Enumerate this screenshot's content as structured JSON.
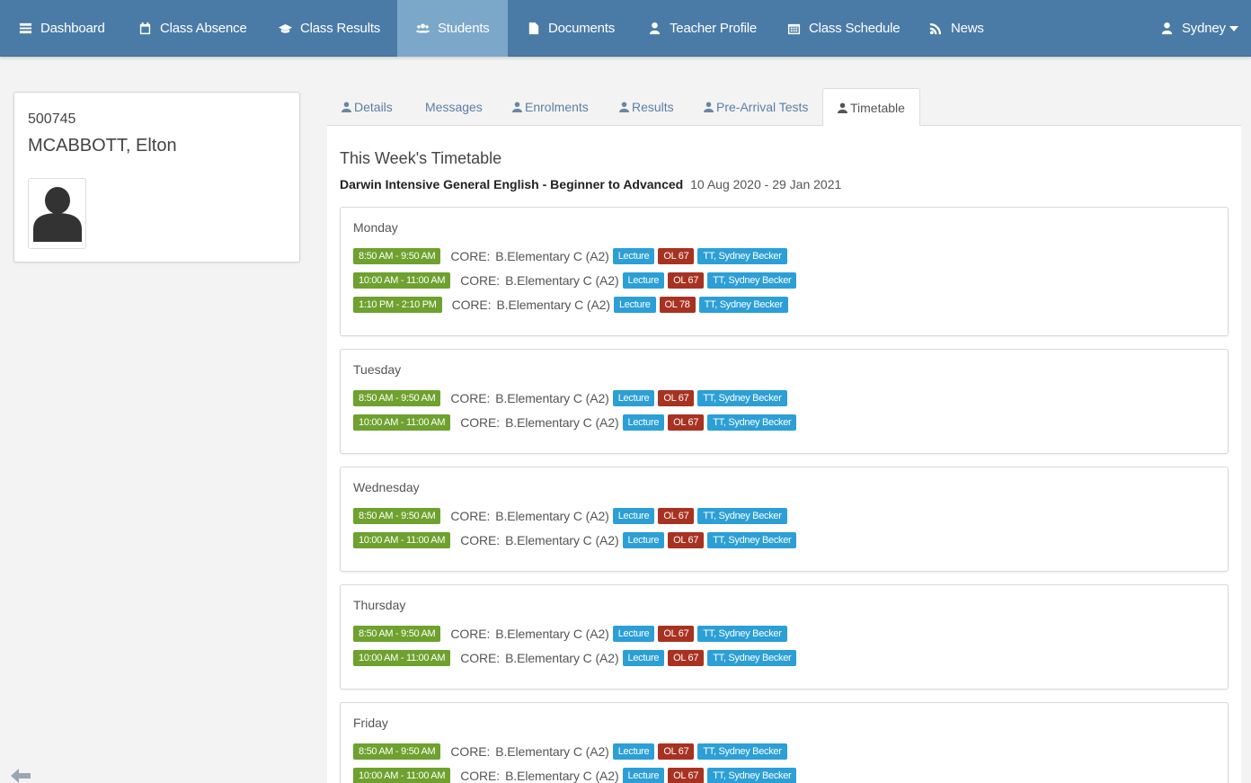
{
  "nav": {
    "dashboard": "Dashboard",
    "class_absence": "Class Absence",
    "class_results": "Class Results",
    "students": "Students",
    "documents": "Documents",
    "teacher_profile": "Teacher Profile",
    "class_schedule": "Class Schedule",
    "news": "News",
    "user": "Sydney"
  },
  "student": {
    "id": "500745",
    "name": "MCABBOTT, Elton"
  },
  "tabs": {
    "details": "Details",
    "messages": "Messages",
    "enrolments": "Enrolments",
    "results": "Results",
    "pre_arrival": "Pre-Arrival Tests",
    "timetable": "Timetable"
  },
  "timetable": {
    "title": "This Week's Timetable",
    "course": "Darwin Intensive General English - Beginner to Advanced",
    "dates": "10 Aug 2020 - 29 Jan 2021",
    "days": [
      {
        "name": "Monday",
        "sessions": [
          {
            "time": "8:50 AM - 9:50 AM",
            "label": "CORE:",
            "class": "B.Elementary C (A2)",
            "type": "Lecture",
            "room": "OL 67",
            "teacher": "TT, Sydney Becker"
          },
          {
            "time": "10:00 AM - 11:00 AM",
            "label": "CORE:",
            "class": "B.Elementary C (A2)",
            "type": "Lecture",
            "room": "OL 67",
            "teacher": "TT, Sydney Becker"
          },
          {
            "time": "1:10 PM - 2:10 PM",
            "label": "CORE:",
            "class": "B.Elementary C (A2)",
            "type": "Lecture",
            "room": "OL 78",
            "teacher": "TT, Sydney Becker"
          }
        ]
      },
      {
        "name": "Tuesday",
        "sessions": [
          {
            "time": "8:50 AM - 9:50 AM",
            "label": "CORE:",
            "class": "B.Elementary C (A2)",
            "type": "Lecture",
            "room": "OL 67",
            "teacher": "TT, Sydney Becker"
          },
          {
            "time": "10:00 AM - 11:00 AM",
            "label": "CORE:",
            "class": "B.Elementary C (A2)",
            "type": "Lecture",
            "room": "OL 67",
            "teacher": "TT, Sydney Becker"
          }
        ]
      },
      {
        "name": "Wednesday",
        "sessions": [
          {
            "time": "8:50 AM - 9:50 AM",
            "label": "CORE:",
            "class": "B.Elementary C (A2)",
            "type": "Lecture",
            "room": "OL 67",
            "teacher": "TT, Sydney Becker"
          },
          {
            "time": "10:00 AM - 11:00 AM",
            "label": "CORE:",
            "class": "B.Elementary C (A2)",
            "type": "Lecture",
            "room": "OL 67",
            "teacher": "TT, Sydney Becker"
          }
        ]
      },
      {
        "name": "Thursday",
        "sessions": [
          {
            "time": "8:50 AM - 9:50 AM",
            "label": "CORE:",
            "class": "B.Elementary C (A2)",
            "type": "Lecture",
            "room": "OL 67",
            "teacher": "TT, Sydney Becker"
          },
          {
            "time": "10:00 AM - 11:00 AM",
            "label": "CORE:",
            "class": "B.Elementary C (A2)",
            "type": "Lecture",
            "room": "OL 67",
            "teacher": "TT, Sydney Becker"
          }
        ]
      },
      {
        "name": "Friday",
        "sessions": [
          {
            "time": "8:50 AM - 9:50 AM",
            "label": "CORE:",
            "class": "B.Elementary C (A2)",
            "type": "Lecture",
            "room": "OL 67",
            "teacher": "TT, Sydney Becker"
          },
          {
            "time": "10:00 AM - 11:00 AM",
            "label": "CORE:",
            "class": "B.Elementary C (A2)",
            "type": "Lecture",
            "room": "OL 67",
            "teacher": "TT, Sydney Becker"
          }
        ]
      }
    ]
  },
  "colors": {
    "navbar": "#4a7ba6",
    "nav_active": "#7ba7c9",
    "time_badge": "#6ea12e",
    "lecture_badge": "#2c9fd6",
    "room_badge": "#a83222",
    "teacher_badge": "#2c9fd6"
  },
  "icons": {
    "dashboard": "list-icon",
    "class_absence": "calendar-icon",
    "class_results": "graduation-cap-icon",
    "students": "users-icon",
    "documents": "document-icon",
    "teacher_profile": "user-icon",
    "class_schedule": "calendar-grid-icon",
    "news": "rss-icon",
    "user": "user-icon",
    "back": "back-arrow-icon"
  }
}
